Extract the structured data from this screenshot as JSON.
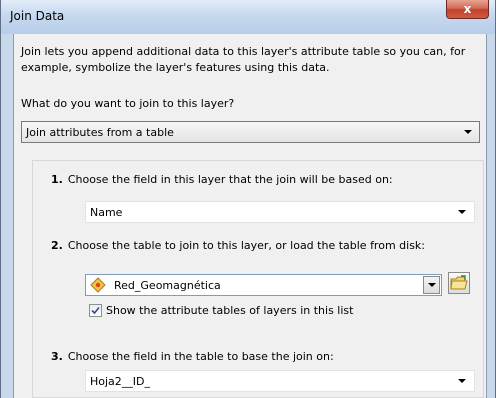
{
  "window": {
    "title": "Join Data",
    "close_glyph": "x"
  },
  "intro": "Join lets you append additional data to this layer's attribute table so you can, for example, symbolize the layer's features using this data.",
  "question": "What do you want to join to this layer?",
  "join_type": {
    "selected": "Join attributes from a table"
  },
  "steps": [
    {
      "number": "1.",
      "label": "Choose the field in this layer that the join will be based on:",
      "value": "Name"
    },
    {
      "number": "2.",
      "label": "Choose the table to join to this layer, or load the table from disk:",
      "value": "Red_Geomagnética",
      "value_icon": "table-layer-icon",
      "browse_icon": "open-folder-icon",
      "checkbox": {
        "checked": true,
        "label": "Show the attribute tables of layers in this list"
      }
    },
    {
      "number": "3.",
      "label": "Choose the field in the table to base the join on:",
      "value": "Hoja2__ID_"
    }
  ],
  "colors": {
    "title_bar": "#c6d8ef",
    "close_button": "#c0412b",
    "dialog_background": "#f0f0f0"
  }
}
